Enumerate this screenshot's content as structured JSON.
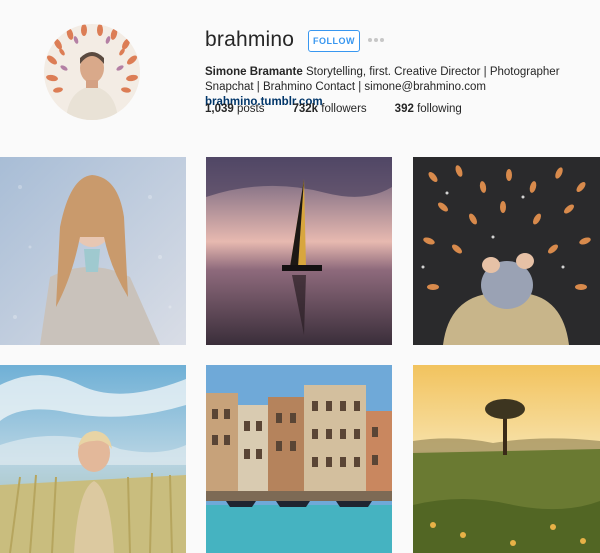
{
  "profile": {
    "username": "brahmino",
    "follow_label": "FOLLOW",
    "more_icon": "more-options-icon",
    "full_name": "Simone Bramante",
    "bio_text": "Storytelling, first. Creative Director | Photographer Snapchat | Brahmino Contact | simone@brahmino.com",
    "bio_link": "brahmino.tumblr.com",
    "stats": {
      "posts_count": "1,039",
      "posts_label": "posts",
      "followers_count": "732k",
      "followers_label": "followers",
      "following_count": "392",
      "following_label": "following"
    }
  },
  "colors": {
    "accent": "#3897f0",
    "link": "#003569",
    "background": "#fafafa"
  }
}
